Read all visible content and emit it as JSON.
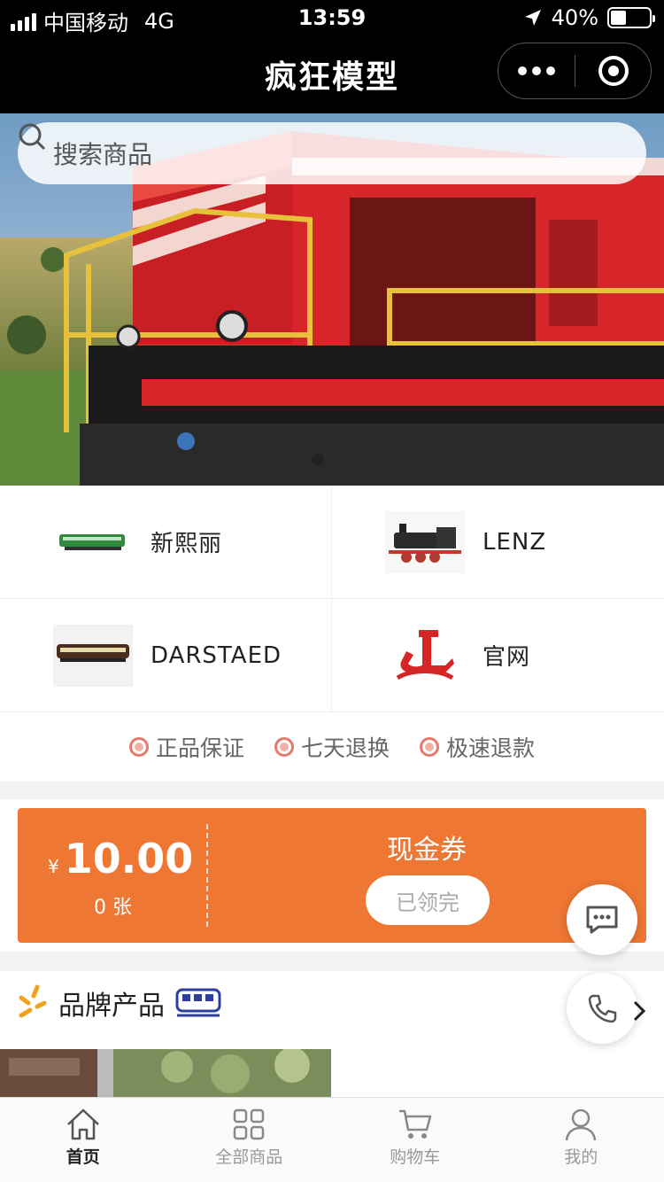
{
  "status_bar": {
    "carrier": "中国移动",
    "network": "4G",
    "time": "13:59",
    "battery": "40%",
    "battery_level": 0.4
  },
  "navbar": {
    "title": "疯狂模型"
  },
  "search": {
    "placeholder": "搜索商品"
  },
  "brands": [
    {
      "label": "新熙丽",
      "icon": "green-train-car-image"
    },
    {
      "label": "LENZ",
      "icon": "steam-locomotive-image"
    },
    {
      "label": "DARSTAED",
      "icon": "passenger-car-image"
    },
    {
      "label": "官网",
      "icon": "red-logo-image"
    }
  ],
  "guarantees": [
    {
      "label": "正品保证"
    },
    {
      "label": "七天退换"
    },
    {
      "label": "极速退款"
    }
  ],
  "coupon": {
    "currency": "¥",
    "amount": "10.00",
    "count": "0 张",
    "title": "现金券",
    "button": "已领完",
    "color": "#ee7733"
  },
  "section": {
    "title": "品牌产品"
  },
  "tabbar": {
    "tabs": [
      {
        "label": "首页",
        "icon": "home-icon",
        "active": true
      },
      {
        "label": "全部商品",
        "icon": "grid-icon",
        "active": false
      },
      {
        "label": "购物车",
        "icon": "cart-icon",
        "active": false
      },
      {
        "label": "我的",
        "icon": "user-icon",
        "active": false
      }
    ]
  }
}
